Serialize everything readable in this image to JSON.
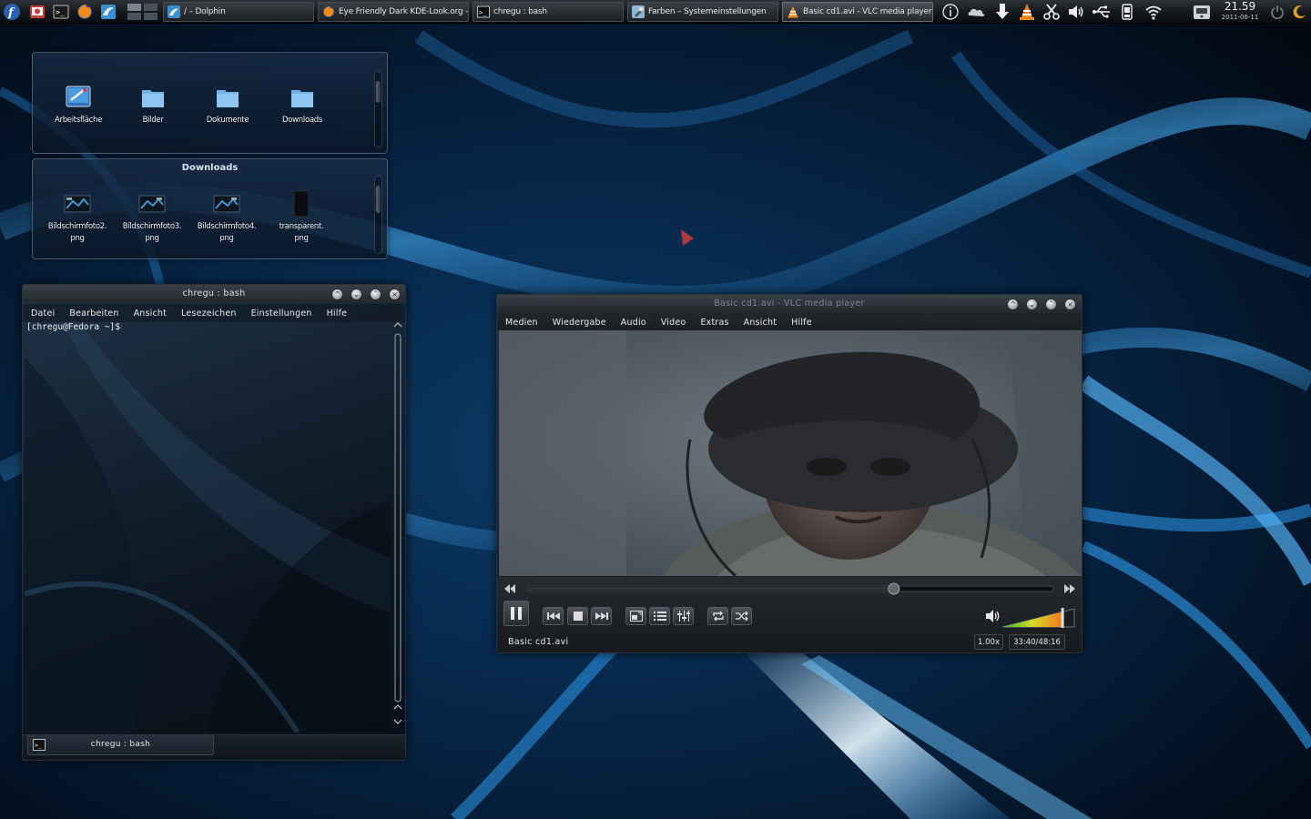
{
  "panel": {
    "tasks": [
      {
        "label": "/ – Dolphin",
        "icon": "dolphin-icon"
      },
      {
        "label": "Eye Friendly Dark KDE-Look.org - M",
        "icon": "firefox-icon"
      },
      {
        "label": "chregu : bash",
        "icon": "terminal-icon"
      },
      {
        "label": "Farben – Systemeinstellungen",
        "icon": "system-settings-icon"
      },
      {
        "label": "Basic cd1.avi - VLC media player",
        "icon": "vlc-icon"
      }
    ],
    "clock_time": "21.59",
    "clock_date": "2011-06-11"
  },
  "places_widget": {
    "items": [
      {
        "label": "Arbeitsfläche",
        "icon": "desktop-folder-icon"
      },
      {
        "label": "Bilder",
        "icon": "folder-icon"
      },
      {
        "label": "Dokumente",
        "icon": "folder-icon"
      },
      {
        "label": "Downloads",
        "icon": "folder-icon"
      }
    ]
  },
  "downloads_widget": {
    "title": "Downloads",
    "items": [
      {
        "line1": "Bildschirmfoto2.",
        "line2": "png"
      },
      {
        "line1": "Bildschirmfoto3.",
        "line2": "png"
      },
      {
        "line1": "Bildschirmfoto4.",
        "line2": "png"
      },
      {
        "line1": "transparent.",
        "line2": "png"
      }
    ]
  },
  "terminal": {
    "title": "chregu : bash",
    "menu": [
      "Datei",
      "Bearbeiten",
      "Ansicht",
      "Lesezeichen",
      "Einstellungen",
      "Hilfe"
    ],
    "prompt": "[chregu@Fedora ~]$",
    "tab_label": "chregu : bash"
  },
  "vlc": {
    "title": "Basic cd1.avi - VLC media player",
    "menu": [
      "Medien",
      "Wiedergabe",
      "Audio",
      "Video",
      "Extras",
      "Ansicht",
      "Hilfe"
    ],
    "filename": "Basic cd1.avi",
    "speed": "1.00x",
    "time": "33:40/48:16",
    "progress": 0.6975,
    "volume": 0.83
  },
  "colors": {
    "accent": "#3a9ad9",
    "volume_low": "#2fb82f",
    "volume_high": "#f07a1a"
  }
}
